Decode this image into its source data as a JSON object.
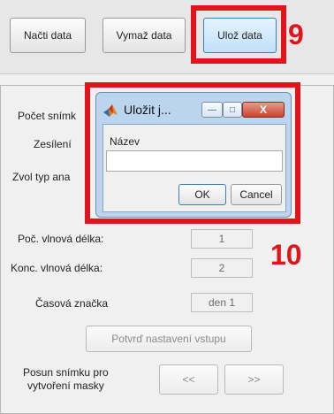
{
  "toolbar": {
    "load_label": "Načti data",
    "clear_label": "Vymaž data",
    "save_label": "Ulož data"
  },
  "annotations": {
    "step9": "9",
    "step10": "10"
  },
  "panel": {
    "frame_count_label": "Počet snímk",
    "gain_label": "Zesílení",
    "analysis_type_label": "Zvol typ ana",
    "start_wavelength_label": "Poč. vlnová délka:",
    "start_wavelength_value": "1",
    "end_wavelength_label": "Konc. vlnová délka:",
    "end_wavelength_value": "2",
    "timestamp_label": "Časová značka",
    "timestamp_value": "den 1",
    "confirm_label": "Potvrď nastavení vstupu",
    "shift_label_line1": "Posun snímku pro",
    "shift_label_line2": "vytvoření masky",
    "prev_label": "<<",
    "next_label": ">>"
  },
  "dialog": {
    "title": "Uložit j...",
    "field_label": "Název",
    "input_value": "",
    "ok_label": "OK",
    "cancel_label": "Cancel",
    "minimize_symbol": "—",
    "maximize_symbol": "□",
    "close_symbol": "X"
  },
  "colors": {
    "annotation_red": "#e1141c",
    "dialog_frame": "#bcd5ef",
    "highlight_button": "#bfe1f9"
  },
  "icons": [
    "matlab-icon",
    "minimize-icon",
    "maximize-icon",
    "close-icon"
  ]
}
